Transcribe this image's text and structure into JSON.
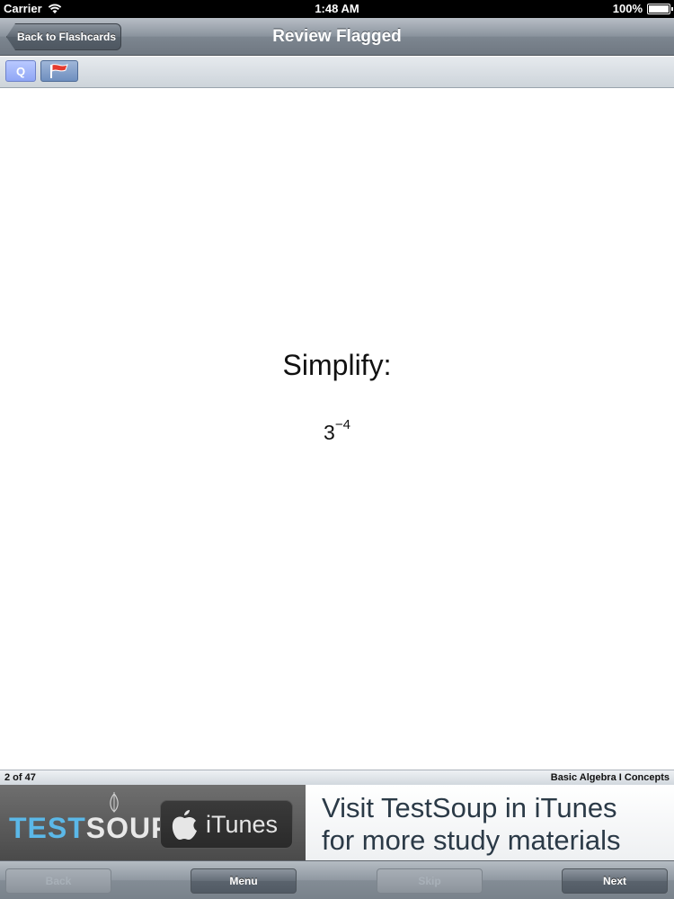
{
  "status_bar": {
    "carrier": "Carrier",
    "time": "1:48 AM",
    "battery": "100%"
  },
  "nav": {
    "back_label": "Back to Flashcards",
    "title": "Review Flagged"
  },
  "toolbar": {
    "question_label": "Q"
  },
  "card": {
    "prompt": "Simplify:",
    "base": "3",
    "exponent": "−4"
  },
  "info": {
    "position": "2 of 47",
    "deck_name": "Basic Algebra I Concepts"
  },
  "ad": {
    "logo_test": "TEST",
    "logo_soup": "SOUP",
    "itunes_label": "iTunes",
    "line1": "Visit TestSoup in iTunes",
    "line2": "for more study materials"
  },
  "bottom_bar": {
    "back_label": "Back",
    "menu_label": "Menu",
    "skip_label": "Skip",
    "next_label": "Next"
  },
  "colors": {
    "accent_blue": "#5bb8e8",
    "flag_red": "#e53a2e"
  }
}
